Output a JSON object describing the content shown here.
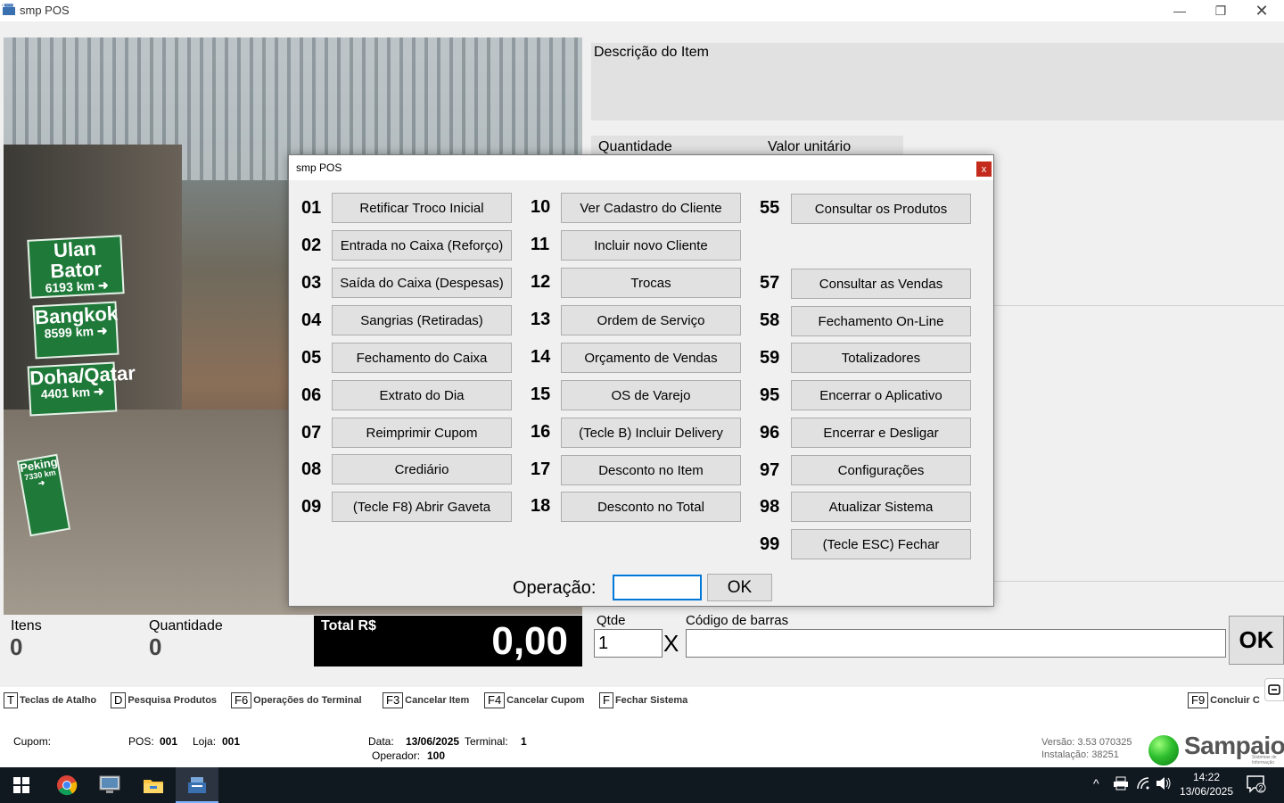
{
  "window": {
    "title": "smp POS",
    "icon_label": "CAIXA"
  },
  "item": {
    "description_label": "Descrição do Item",
    "quantity_label": "Quantidade",
    "unit_price_label": "Valor unitário"
  },
  "photo_signs": [
    {
      "city": "Ulan Bator",
      "dist": "6193 km ➜"
    },
    {
      "city": "Bangkok",
      "dist": "8599 km ➜"
    },
    {
      "city": "Doha/Qatar",
      "dist": "4401 km ➜"
    },
    {
      "city": "Peking",
      "dist": "7330 km ➜"
    }
  ],
  "summary": {
    "items_label": "Itens",
    "items_value": "0",
    "qty_label": "Quantidade",
    "qty_value": "0",
    "total_label": "Total R$",
    "total_value": "0,00"
  },
  "entry": {
    "qtde_label": "Qtde",
    "qtde_value": "1",
    "x": "X",
    "barcode_label": "Código de barras",
    "ok_label": "OK"
  },
  "shortcuts": [
    {
      "key": "T",
      "label": "Teclas de Atalho"
    },
    {
      "key": "D",
      "label": "Pesquisa Produtos"
    },
    {
      "key": "F6",
      "label": "Operações do Terminal"
    },
    {
      "key": "F3",
      "label": "Cancelar Item"
    },
    {
      "key": "F4",
      "label": "Cancelar Cupom"
    },
    {
      "key": "F",
      "label": "Fechar Sistema"
    },
    {
      "key": "F9",
      "label": "Concluir C"
    }
  ],
  "status": {
    "cupom_label": "Cupom:",
    "pos_label": "POS:",
    "pos_value": "001",
    "loja_label": "Loja:",
    "loja_value": "001",
    "data_label": "Data:",
    "data_value": "13/06/2025",
    "terminal_label": "Terminal:",
    "terminal_value": "1",
    "operador_label": "Operador:",
    "operador_value": "100",
    "versao": "Versão: 3.53 070325",
    "instalacao": "Instalação: 38251",
    "logo": "Sampaio",
    "logo_sub": "Sistemas de Informação"
  },
  "dialog": {
    "title": "smp POS",
    "close": "x",
    "operation_label": "Operação:",
    "ok_label": "OK",
    "col1": [
      {
        "num": "01",
        "label": "Retificar Troco Inicial"
      },
      {
        "num": "02",
        "label": "Entrada no Caixa (Reforço)"
      },
      {
        "num": "03",
        "label": "Saída do Caixa (Despesas)"
      },
      {
        "num": "04",
        "label": "Sangrias (Retiradas)"
      },
      {
        "num": "05",
        "label": "Fechamento do Caixa"
      },
      {
        "num": "06",
        "label": "Extrato do Dia"
      },
      {
        "num": "07",
        "label": "Reimprimir Cupom"
      },
      {
        "num": "08",
        "label": "Crediário"
      },
      {
        "num": "09",
        "label": "(Tecle F8) Abrir Gaveta"
      }
    ],
    "col2": [
      {
        "num": "10",
        "label": "Ver Cadastro do Cliente"
      },
      {
        "num": "11",
        "label": "Incluir novo Cliente"
      },
      {
        "num": "12",
        "label": "Trocas"
      },
      {
        "num": "13",
        "label": "Ordem de Serviço"
      },
      {
        "num": "14",
        "label": "Orçamento de Vendas"
      },
      {
        "num": "15",
        "label": "OS de Varejo"
      },
      {
        "num": "16",
        "label": "(Tecle B) Incluir Delivery"
      },
      {
        "num": "17",
        "label": "Desconto no Item"
      },
      {
        "num": "18",
        "label": "Desconto no Total"
      }
    ],
    "col3": [
      {
        "num": "55",
        "label": "Consultar os Produtos"
      },
      {
        "num": "57",
        "label": "Consultar as Vendas"
      },
      {
        "num": "58",
        "label": "Fechamento On-Line"
      },
      {
        "num": "59",
        "label": "Totalizadores"
      },
      {
        "num": "95",
        "label": "Encerrar o Aplicativo"
      },
      {
        "num": "96",
        "label": "Encerrar e Desligar"
      },
      {
        "num": "97",
        "label": "Configurações"
      },
      {
        "num": "98",
        "label": "Atualizar Sistema"
      },
      {
        "num": "99",
        "label": "(Tecle ESC) Fechar"
      }
    ]
  },
  "taskbar": {
    "time": "14:22",
    "date": "13/06/2025",
    "notif_count": "2"
  }
}
